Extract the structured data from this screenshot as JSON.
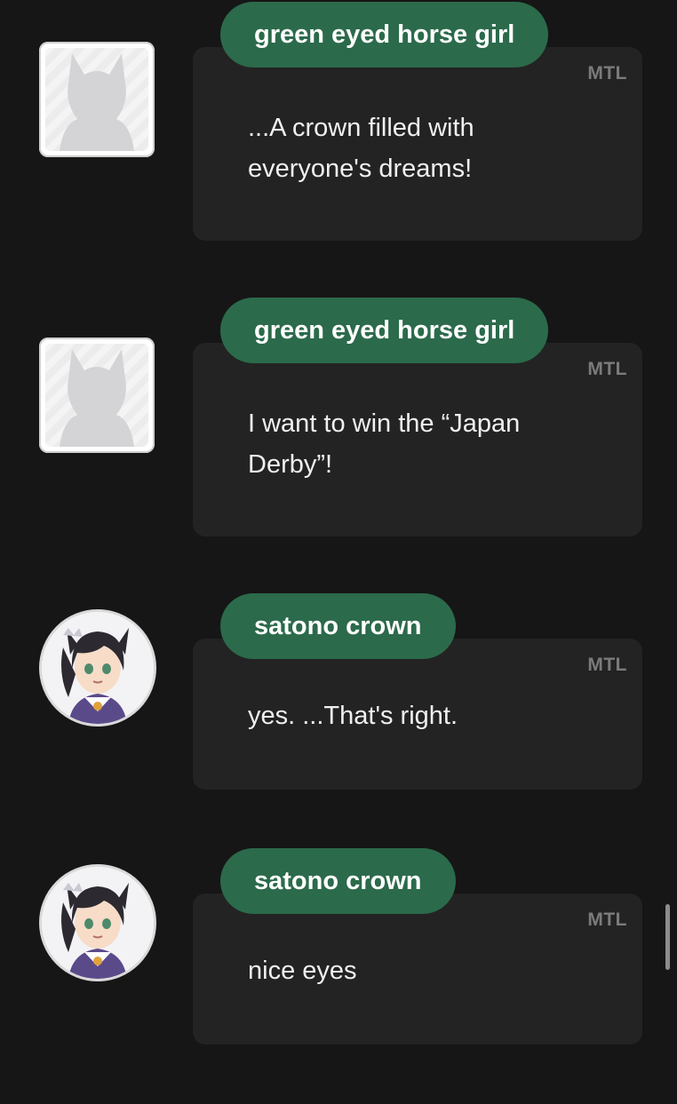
{
  "messages": [
    {
      "speaker": "green eyed horse girl",
      "badge": "MTL",
      "text": "...A crown filled with everyone's dreams!",
      "avatar": "placeholder-silhouette-icon"
    },
    {
      "speaker": "green eyed horse girl",
      "badge": "MTL",
      "text": "I want to win the “Japan Derby”!",
      "avatar": "placeholder-silhouette-icon"
    },
    {
      "speaker": "satono crown",
      "badge": "MTL",
      "text": "yes. ...That's right.",
      "avatar": "character-portrait"
    },
    {
      "speaker": "satono crown",
      "badge": "MTL",
      "text": "nice eyes",
      "avatar": "character-portrait"
    }
  ],
  "colors": {
    "background": "#161616",
    "bubble": "#232323",
    "name_pill": "#2b6a4b",
    "text": "#f0f0f0",
    "badge": "#7b7b7b"
  }
}
